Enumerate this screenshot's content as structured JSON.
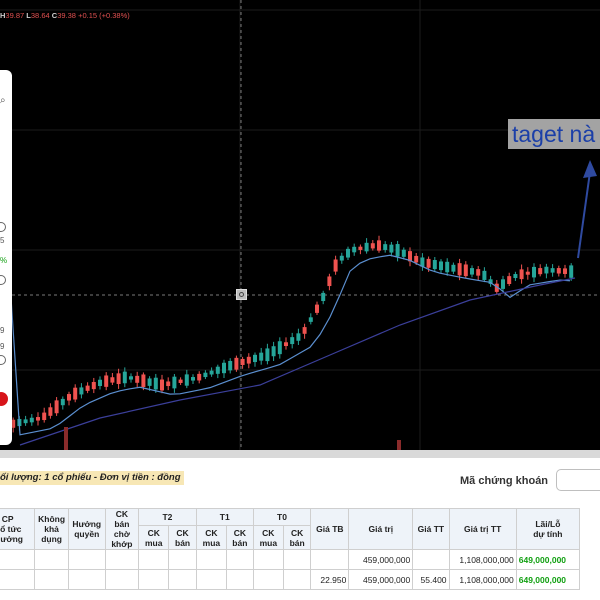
{
  "ohlc": {
    "h_label": "H",
    "h": "39.87",
    "l_label": "L",
    "l": "38.64",
    "c_label": "C",
    "c": "39.38",
    "change": "+0.15 (+0.38%)"
  },
  "annotation": {
    "target_text": "taget nà"
  },
  "side_panel": {
    "search_icon": "search-icon",
    "labels": [
      "5",
      "%",
      "9",
      "9"
    ]
  },
  "holdings": {
    "unit_note": "ối lượng: 1 cổ phiếu - Đơn vị tiền : đồng",
    "symbol_label": "Mã chứng khoán",
    "headers": {
      "cp_bonus": "CP\nCổ tức\nthưởng",
      "unavailable": "Không\nkhả\ndụng",
      "entitled": "Hưởng\nquyền",
      "pending_sell": "CK bán\nchờ\nkhớp",
      "t2": "T2",
      "t1": "T1",
      "t0": "T0",
      "buy": "CK\nmua",
      "sell": "CK\nbán",
      "avg_price": "Giá TB",
      "value": "Giá trị",
      "market_price": "Giá TT",
      "market_value": "Giá trị TT",
      "pnl": "Lãi/Lỗ\ndự tính"
    },
    "rows": [
      {
        "avg_price": "",
        "value": "459,000,000",
        "market_price": "",
        "market_value": "1,108,000,000",
        "pnl": "649,000,000"
      },
      {
        "avg_price": "22.950",
        "value": "459,000,000",
        "market_price": "55.400",
        "market_value": "1,108,000,000",
        "pnl": "649,000,000"
      }
    ]
  },
  "colors": {
    "up": "#26a69a",
    "down": "#ef5350",
    "ma_fast": "#5b8fd0",
    "ma_slow": "#3b3f9a",
    "annotation_bg": "#a3a3a3",
    "annotation_text": "#1b3fa8",
    "profit": "#12a012"
  }
}
